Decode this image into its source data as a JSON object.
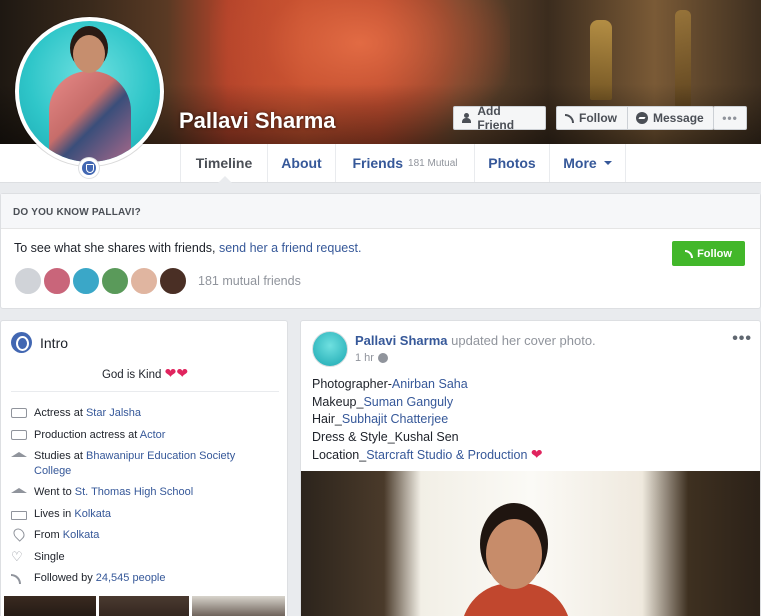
{
  "profile": {
    "name": "Pallavi Sharma",
    "buttons": {
      "add_friend": "Add Friend",
      "follow": "Follow",
      "message": "Message",
      "more": "•••"
    }
  },
  "nav": {
    "tabs": [
      "Timeline",
      "About",
      "Friends",
      "Photos",
      "More"
    ],
    "friends_mutual": "181 Mutual"
  },
  "know": {
    "header": "DO YOU KNOW PALLAVI?",
    "text": "To see what she shares with friends,",
    "link": "send her a friend request.",
    "follow": "Follow",
    "mutual": "181 mutual friends",
    "avatar_colors": [
      "#d0d3d8",
      "#c9657a",
      "#3aa7c8",
      "#5a9a5a",
      "#e0b5a0",
      "#4a2f25"
    ]
  },
  "intro": {
    "title": "Intro",
    "bio": "God is Kind",
    "rows": [
      {
        "prefix": "Actress at ",
        "link": "Star Jalsha",
        "suffix": ""
      },
      {
        "prefix": "Production actress at ",
        "link": "Actor",
        "suffix": ""
      },
      {
        "prefix": "Studies at ",
        "link": "Bhawanipur Education Society College",
        "suffix": ""
      },
      {
        "prefix": "Went to ",
        "link": "St. Thomas High School",
        "suffix": ""
      },
      {
        "prefix": "Lives in ",
        "link": "Kolkata",
        "suffix": ""
      },
      {
        "prefix": "From ",
        "link": "Kolkata",
        "suffix": ""
      },
      {
        "prefix": "Single",
        "link": "",
        "suffix": ""
      },
      {
        "prefix": "Followed by ",
        "link": "24,545 people",
        "suffix": ""
      }
    ]
  },
  "post": {
    "author": "Pallavi Sharma",
    "action": "updated her cover photo.",
    "time": "1 hr",
    "dots": "•••",
    "lines": [
      {
        "text": "Photographer-",
        "link": "Anirban Saha"
      },
      {
        "text": "Makeup_",
        "link": "Suman Ganguly"
      },
      {
        "text": "Hair_",
        "link": "Subhajit Chatterjee"
      },
      {
        "text": "Dress & Style_Kushal Sen",
        "link": ""
      },
      {
        "text": "Location_",
        "link": "Starcraft Studio & Production"
      }
    ]
  }
}
